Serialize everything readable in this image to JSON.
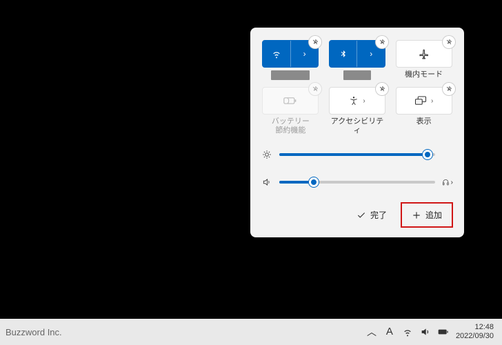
{
  "taskbar": {
    "brand": "Buzzword Inc.",
    "clock_time": "12:48",
    "clock_date": "2022/09/30"
  },
  "panel": {
    "tiles": [
      {
        "id": "wifi",
        "label": "",
        "redacted": true,
        "on": true,
        "split": true,
        "pin": true
      },
      {
        "id": "bluetooth",
        "label": "",
        "redacted": true,
        "on": true,
        "split": true,
        "pin": true
      },
      {
        "id": "airplane",
        "label": "機内モード",
        "on": false,
        "split": false,
        "pin": true
      },
      {
        "id": "battery-saver",
        "label": "バッテリー\n節約機能",
        "on": false,
        "split": false,
        "pin": true,
        "disabled": true
      },
      {
        "id": "accessibility",
        "label": "アクセシビリティ",
        "on": false,
        "split": true,
        "pin": true
      },
      {
        "id": "project",
        "label": "表示",
        "on": false,
        "split": true,
        "pin": true
      }
    ],
    "brightness_pct": 95,
    "volume_pct": 22,
    "footer": {
      "done": "完了",
      "add": "追加"
    }
  }
}
